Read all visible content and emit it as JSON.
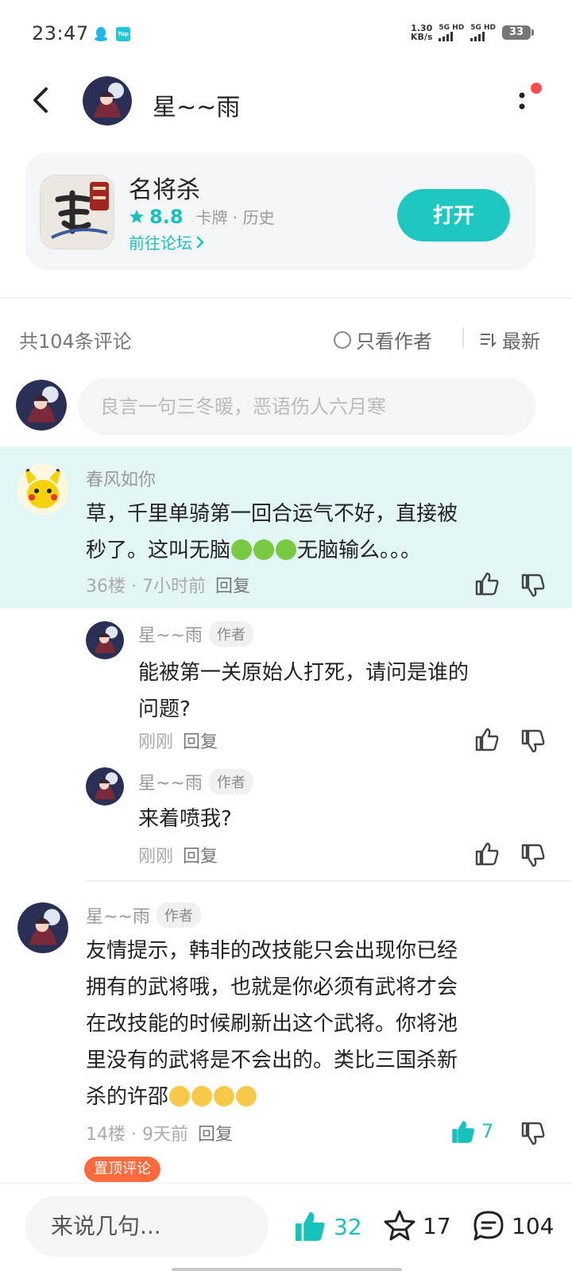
{
  "status_bar": {
    "time": "23:47",
    "net_speed_value": "1.30",
    "net_speed_unit": "KB/s",
    "signal1": "5G HD",
    "signal2": "5G HD",
    "battery": "33"
  },
  "header": {
    "title": "星~~雨"
  },
  "app_card": {
    "name": "名将杀",
    "rating": "8.8",
    "tags": "卡牌 · 历史",
    "forum_link": "前往论坛",
    "open_button": "打开"
  },
  "comments_toolbar": {
    "count_label": "共104条评论",
    "author_only": "只看作者",
    "sort_label": "最新"
  },
  "compose": {
    "placeholder": "良言一句三冬暖，恶语伤人六月寒"
  },
  "comments": [
    {
      "user": "春风如你",
      "text_line1": "草，千里单骑第一回合运气不好，直接被",
      "text_line2_pre": "秒了。这叫无脑",
      "text_line2_post": "无脑输么。。。",
      "floor": "36楼",
      "time": "7小时前",
      "reply": "回复",
      "replies": [
        {
          "user": "星~~雨",
          "tag": "作者",
          "text_line1": "能被第一关原始人打死，请问是谁的",
          "text_line2": "问题?",
          "time": "刚刚",
          "reply": "回复"
        },
        {
          "user": "星~~雨",
          "tag": "作者",
          "text_line1": "来着喷我?",
          "time": "刚刚",
          "reply": "回复"
        }
      ]
    },
    {
      "user": "星~~雨",
      "tag": "作者",
      "lines": [
        "友情提示，韩非的改技能只会出现你已经",
        "拥有的武将哦，也就是你必须有武将才会",
        "在改技能的时候刷新出这个武将。你将池",
        "里没有的武将是不会出的。类比三国杀新"
      ],
      "last_line": "杀的许邵",
      "floor": "14楼",
      "time": "9天前",
      "reply": "回复",
      "likes": "7",
      "pinned": "置顶评论"
    }
  ],
  "bottom_bar": {
    "input_label": "来说几句...",
    "likes": "32",
    "favorites": "17",
    "comments": "104"
  }
}
